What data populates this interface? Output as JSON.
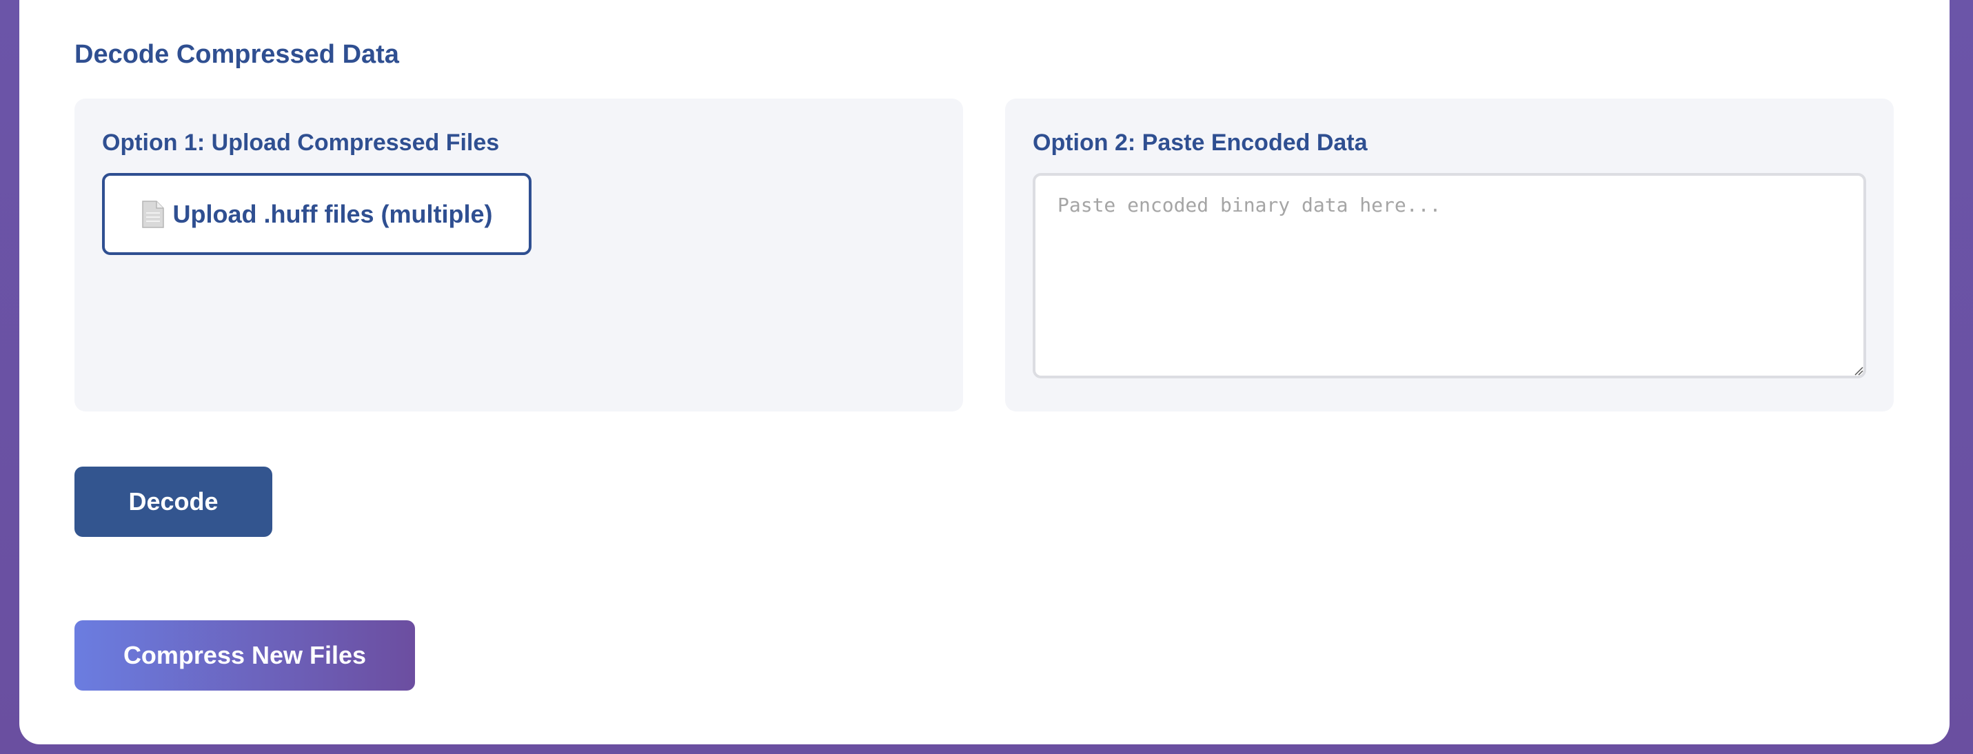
{
  "decode_section": {
    "title": "Decode Compressed Data",
    "option1": {
      "title": "Option 1: Upload Compressed Files",
      "upload_label": "Upload .huff files (multiple)",
      "icon": "file-icon"
    },
    "option2": {
      "title": "Option 2: Paste Encoded Data",
      "textarea_value": "",
      "textarea_placeholder": "Paste encoded binary data here..."
    },
    "decode_label": "Decode"
  },
  "compress_new_label": "Compress New Files",
  "colors": {
    "primary": "#2f4f91",
    "decode_button": "#33558f",
    "gradient_start": "#6b7de0",
    "gradient_end": "#6c4ea0",
    "panel_bg": "#f4f5f9",
    "page_bg": "#6a4fa0"
  }
}
